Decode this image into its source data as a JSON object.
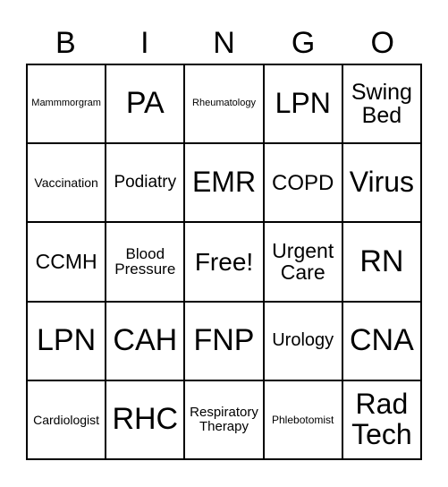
{
  "header": [
    "B",
    "I",
    "N",
    "G",
    "O"
  ],
  "cells": [
    "Mammmorgram",
    "PA",
    "Rheumatology",
    "LPN",
    "Swing Bed",
    "Vaccination",
    "Podiatry",
    "EMR",
    "COPD",
    "Virus",
    "CCMH",
    "Blood Pressure",
    "Free!",
    "Urgent Care",
    "RN",
    "LPN",
    "CAH",
    "FNP",
    "Urology",
    "CNA",
    "Cardiologist",
    "RHC",
    "Respiratory Therapy",
    "Phlebotomist",
    "Rad Tech"
  ]
}
